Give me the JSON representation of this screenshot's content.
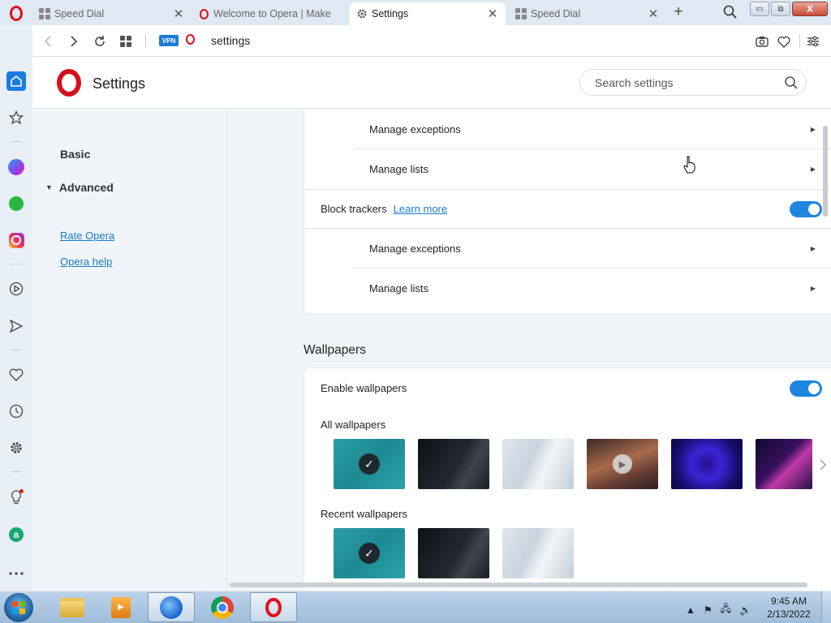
{
  "tabs": [
    {
      "title": "Speed Dial",
      "icon": "speed-dial-icon"
    },
    {
      "title": "Welcome to Opera | Make",
      "icon": "opera-icon"
    },
    {
      "title": "Settings",
      "icon": "gear-icon"
    },
    {
      "title": "Speed Dial",
      "icon": "speed-dial-icon"
    }
  ],
  "window_controls": {
    "minimize": "▭",
    "restore": "⧉",
    "close": "X"
  },
  "address_bar": {
    "url": "settings",
    "vpn_label": "VPN"
  },
  "settings": {
    "title": "Settings",
    "search_placeholder": "Search settings"
  },
  "nav": {
    "basic": "Basic",
    "advanced": "Advanced",
    "rate_opera": "Rate Opera",
    "opera_help": "Opera help"
  },
  "ad_block": {
    "manage_exceptions": "Manage exceptions",
    "manage_lists": "Manage lists"
  },
  "trackers": {
    "label": "Block trackers",
    "learn_more": "Learn more",
    "manage_exceptions": "Manage exceptions",
    "manage_lists": "Manage lists",
    "enabled": true
  },
  "wallpapers": {
    "section_title": "Wallpapers",
    "enable_label": "Enable wallpapers",
    "enabled": true,
    "all_label": "All wallpapers",
    "recent_label": "Recent wallpapers"
  },
  "taskbar": {
    "time": "9:45 AM",
    "date": "2/13/2022"
  },
  "colors": {
    "accent": "#1e86e0",
    "opera_red": "#e0101c",
    "link": "#1a7bc8"
  }
}
